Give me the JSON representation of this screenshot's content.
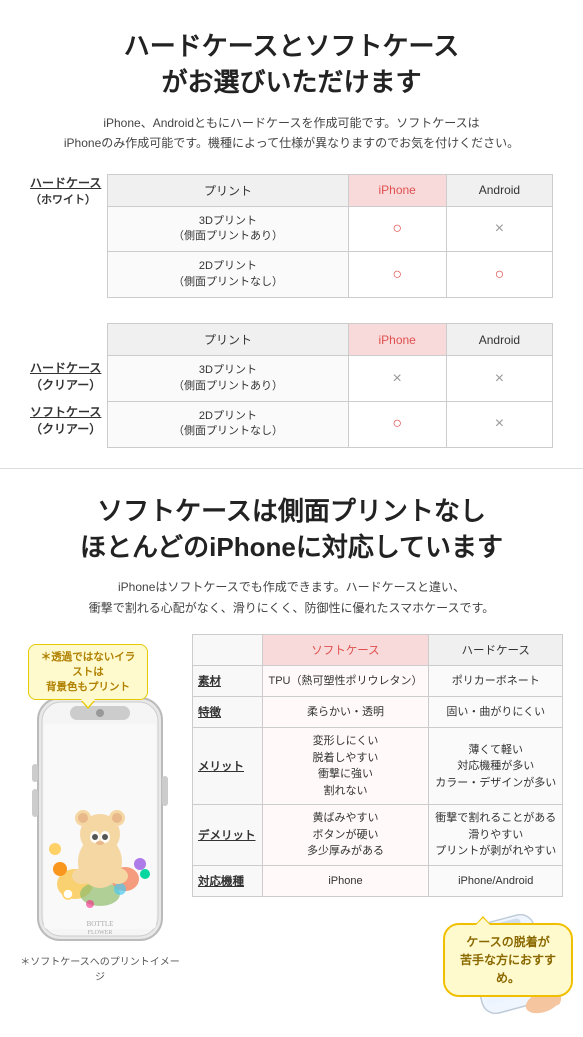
{
  "section1": {
    "title": "ハードケースとソフトケース\nがお選びいただけます",
    "subtitle": "iPhone、Androidともにハードケースを作成可能です。ソフトケースは\niPhoneのみ作成可能です。機種によって仕様が異なりますのでお気を付けください。",
    "table1": {
      "header": [
        "プリント",
        "iPhone",
        "Android"
      ],
      "leftLabel": "ハードケース\n（ホワイト）",
      "rows": [
        {
          "print": "3Dプリント\n（側面プリントあり）",
          "iphone": "○",
          "android": "×"
        },
        {
          "print": "2Dプリント\n（側面プリントなし）",
          "iphone": "○",
          "android": "○"
        }
      ]
    },
    "table2": {
      "header": [
        "プリント",
        "iPhone",
        "Android"
      ],
      "leftLabels": [
        "ハードケース\n（クリアー）",
        "ソフトケース\n（クリアー）"
      ],
      "rows": [
        {
          "print": "3Dプリント\n（側面プリントあり）",
          "iphone": "×",
          "android": "×"
        },
        {
          "print": "2Dプリント\n（側面プリントなし）",
          "iphone": "○",
          "android": "×"
        }
      ]
    }
  },
  "section2": {
    "title": "ソフトケースは側面プリントなし\nほとんどのiPhoneに対応しています",
    "subtitle": "iPhoneはソフトケースでも作成できます。ハードケースと違い、\n衝撃で割れる心配がなく、滑りにくく、防御性に優れたスマホケースです。",
    "balloon_text": "＊透過ではないイラストは\n背景色もプリント",
    "phone_caption": "＊ソフトケースへのプリントイメージ",
    "table": {
      "headers": [
        "ソフトケース",
        "ハードケース"
      ],
      "rows": [
        {
          "label": "素材",
          "soft": "TPU（熱可塑性ポリウレタン）",
          "hard": "ポリカーボネート"
        },
        {
          "label": "特徴",
          "soft": "柔らかい・透明",
          "hard": "固い・曲がりにくい"
        },
        {
          "label": "メリット",
          "soft": "変形しにくい\n脱着しやすい\n衝撃に強い\n割れない",
          "hard": "薄くて軽い\n対応機種が多い\nカラー・デザインが多い"
        },
        {
          "label": "デメリット",
          "soft": "黄ばみやすい\nボタンが硬い\n多少厚みがある",
          "hard": "衝撃で割れることがある\n滑りやすい\nプリントが剥がれやすい"
        },
        {
          "label": "対応機種",
          "soft": "iPhone",
          "hard": "iPhone/Android"
        }
      ]
    },
    "footer_balloon": "ケースの脱着が\n苦手な方におすすめ。"
  }
}
